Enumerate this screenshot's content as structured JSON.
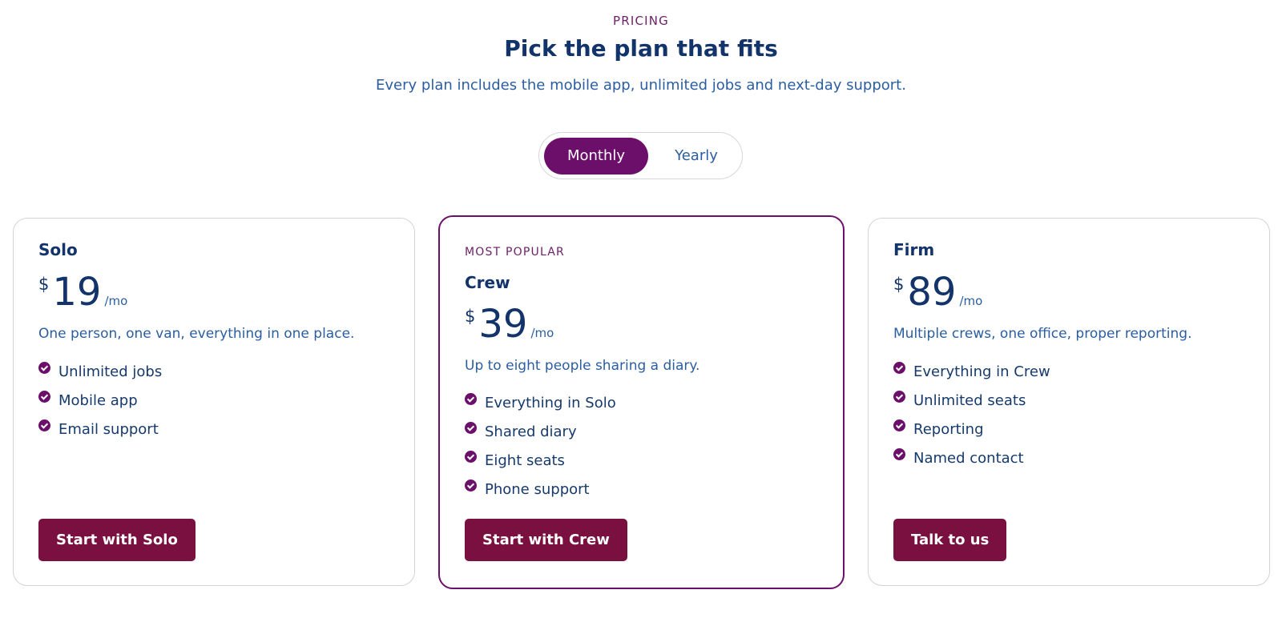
{
  "header": {
    "eyebrow": "PRICING",
    "title": "Pick the plan that fits",
    "subtitle": "Every plan includes the mobile app, unlimited jobs and next-day support."
  },
  "billing_toggle": {
    "options": [
      "Monthly",
      "Yearly"
    ],
    "selected": "Monthly"
  },
  "plans": [
    {
      "name": "Solo",
      "currency": "$",
      "price": "19",
      "period": "/mo",
      "description": "One person, one van, everything in one place.",
      "features": [
        "Unlimited jobs",
        "Mobile app",
        "Email support"
      ],
      "cta": "Start with Solo"
    },
    {
      "badge": "MOST POPULAR",
      "name": "Crew",
      "currency": "$",
      "price": "39",
      "period": "/mo",
      "description": "Up to eight people sharing a diary.",
      "features": [
        "Everything in Solo",
        "Shared diary",
        "Eight seats",
        "Phone support"
      ],
      "cta": "Start with Crew"
    },
    {
      "name": "Firm",
      "currency": "$",
      "price": "89",
      "period": "/mo",
      "description": "Multiple crews, one office, proper reporting.",
      "features": [
        "Everything in Crew",
        "Unlimited seats",
        "Reporting",
        "Named contact"
      ],
      "cta": "Talk to us"
    }
  ],
  "colors": {
    "accent": "#6c0f6a",
    "button": "#7a1040",
    "heading": "#12346a",
    "text_blue": "#2a5ea1"
  }
}
